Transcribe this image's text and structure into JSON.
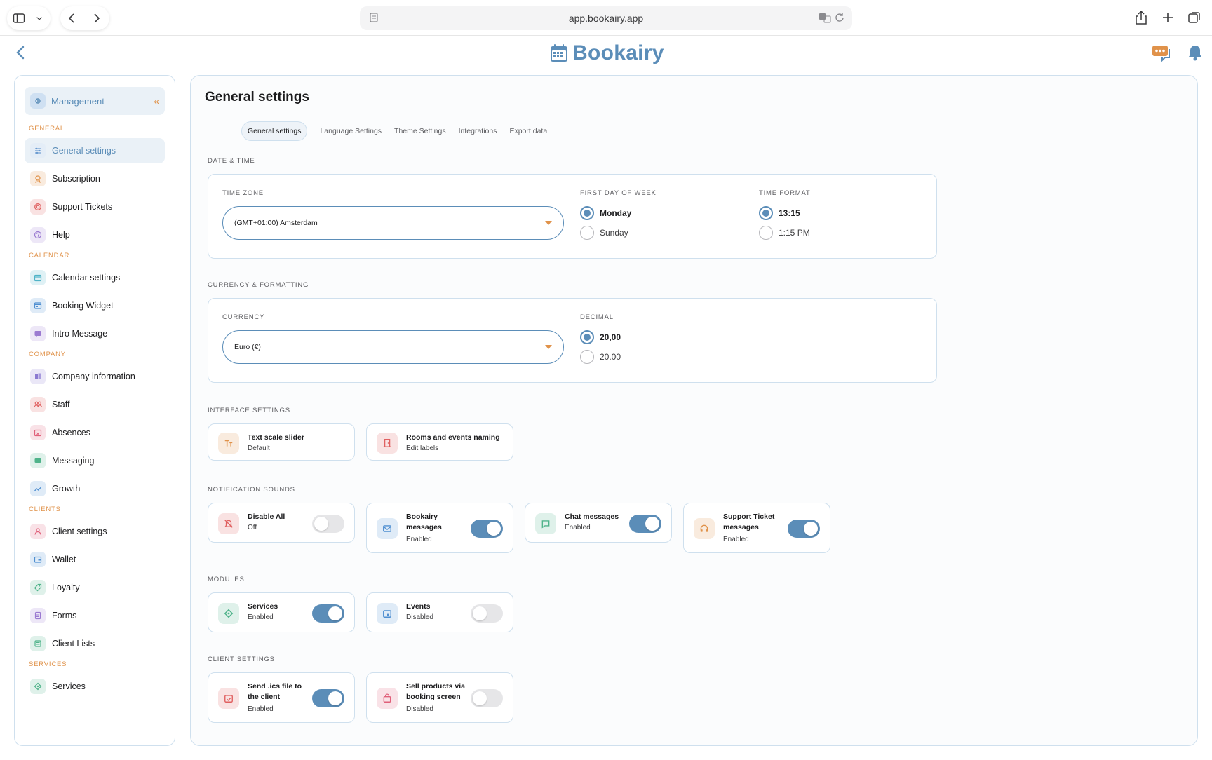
{
  "browser": {
    "url": "app.bookairy.app"
  },
  "app": {
    "name": "Bookairy"
  },
  "sidebar": {
    "header": "Management",
    "sections": [
      {
        "title": "GENERAL",
        "items": [
          {
            "label": "General settings",
            "icon": "sliders-icon",
            "color": "#6b9bd1",
            "active": true
          },
          {
            "label": "Subscription",
            "icon": "badge-icon",
            "color": "#e0924a"
          },
          {
            "label": "Support Tickets",
            "icon": "lifebuoy-icon",
            "color": "#e06060"
          },
          {
            "label": "Help",
            "icon": "question-icon",
            "color": "#9b7ad1"
          }
        ]
      },
      {
        "title": "CALENDAR",
        "items": [
          {
            "label": "Calendar settings",
            "icon": "calendar-icon",
            "color": "#4fb3c7"
          },
          {
            "label": "Booking Widget",
            "icon": "widget-icon",
            "color": "#4f8fd1"
          },
          {
            "label": "Intro Message",
            "icon": "message-icon",
            "color": "#9b7ad1"
          }
        ]
      },
      {
        "title": "COMPANY",
        "items": [
          {
            "label": "Company information",
            "icon": "building-icon",
            "color": "#8b7ad1"
          },
          {
            "label": "Staff",
            "icon": "people-icon",
            "color": "#e06060"
          },
          {
            "label": "Absences",
            "icon": "calendar-x-icon",
            "color": "#e0607a"
          },
          {
            "label": "Messaging",
            "icon": "chat-icon",
            "color": "#4fb38a"
          },
          {
            "label": "Growth",
            "icon": "trend-icon",
            "color": "#4f8fd1"
          }
        ]
      },
      {
        "title": "CLIENTS",
        "items": [
          {
            "label": "Client settings",
            "icon": "person-icon",
            "color": "#e0607a"
          },
          {
            "label": "Wallet",
            "icon": "wallet-icon",
            "color": "#4f8fd1"
          },
          {
            "label": "Loyalty",
            "icon": "tag-icon",
            "color": "#4fb38a"
          },
          {
            "label": "Forms",
            "icon": "form-icon",
            "color": "#9b7ad1"
          },
          {
            "label": "Client Lists",
            "icon": "list-icon",
            "color": "#4fb38a"
          }
        ]
      },
      {
        "title": "SERVICES",
        "items": [
          {
            "label": "Services",
            "icon": "diamond-icon",
            "color": "#4fb38a"
          }
        ]
      }
    ]
  },
  "main": {
    "title": "General settings",
    "tabs": [
      "General settings",
      "Language Settings",
      "Theme Settings",
      "Integrations",
      "Export data"
    ],
    "date_time": {
      "section": "DATE & TIME",
      "timezone_label": "TIME ZONE",
      "timezone_value": "(GMT+01:00) Amsterdam",
      "first_day_label": "FIRST DAY OF WEEK",
      "first_day_options": [
        "Monday",
        "Sunday"
      ],
      "first_day_selected": "Monday",
      "time_format_label": "TIME FORMAT",
      "time_format_options": [
        "13:15",
        "1:15 PM"
      ],
      "time_format_selected": "13:15"
    },
    "currency": {
      "section": "CURRENCY & FORMATTING",
      "currency_label": "CURRENCY",
      "currency_value": "Euro (€)",
      "decimal_label": "DECIMAL",
      "decimal_options": [
        "20,00",
        "20.00"
      ],
      "decimal_selected": "20,00"
    },
    "interface": {
      "section": "INTERFACE SETTINGS",
      "tiles": [
        {
          "title": "Text scale slider",
          "sub": "Default",
          "icon": "text-size-icon",
          "color": "#e0924a"
        },
        {
          "title": "Rooms and events naming",
          "sub": "Edit labels",
          "icon": "door-icon",
          "color": "#e06060"
        }
      ]
    },
    "sounds": {
      "section": "NOTIFICATION SOUNDS",
      "tiles": [
        {
          "title": "Disable All",
          "sub": "Off",
          "on": false,
          "icon": "bell-off-icon",
          "color": "#e06060"
        },
        {
          "title": "Bookairy messages",
          "sub": "Enabled",
          "on": true,
          "icon": "mail-icon",
          "color": "#4f8fd1"
        },
        {
          "title": "Chat messages",
          "sub": "Enabled",
          "on": true,
          "icon": "chat-bubble-icon",
          "color": "#4fb38a"
        },
        {
          "title": "Support Ticket messages",
          "sub": "Enabled",
          "on": true,
          "icon": "headset-icon",
          "color": "#e0924a"
        }
      ]
    },
    "modules": {
      "section": "MODULES",
      "tiles": [
        {
          "title": "Services",
          "sub": "Enabled",
          "on": true,
          "icon": "diamond-icon",
          "color": "#4fb38a"
        },
        {
          "title": "Events",
          "sub": "Disabled",
          "on": false,
          "icon": "calendar-event-icon",
          "color": "#4f8fd1"
        }
      ]
    },
    "client_settings": {
      "section": "CLIENT SETTINGS",
      "tiles": [
        {
          "title": "Send .ics file to the client",
          "sub": "Enabled",
          "on": true,
          "icon": "calendar-check-icon",
          "color": "#e06060"
        },
        {
          "title": "Sell products via booking screen",
          "sub": "Disabled",
          "on": false,
          "icon": "bag-icon",
          "color": "#e0607a"
        }
      ]
    }
  }
}
